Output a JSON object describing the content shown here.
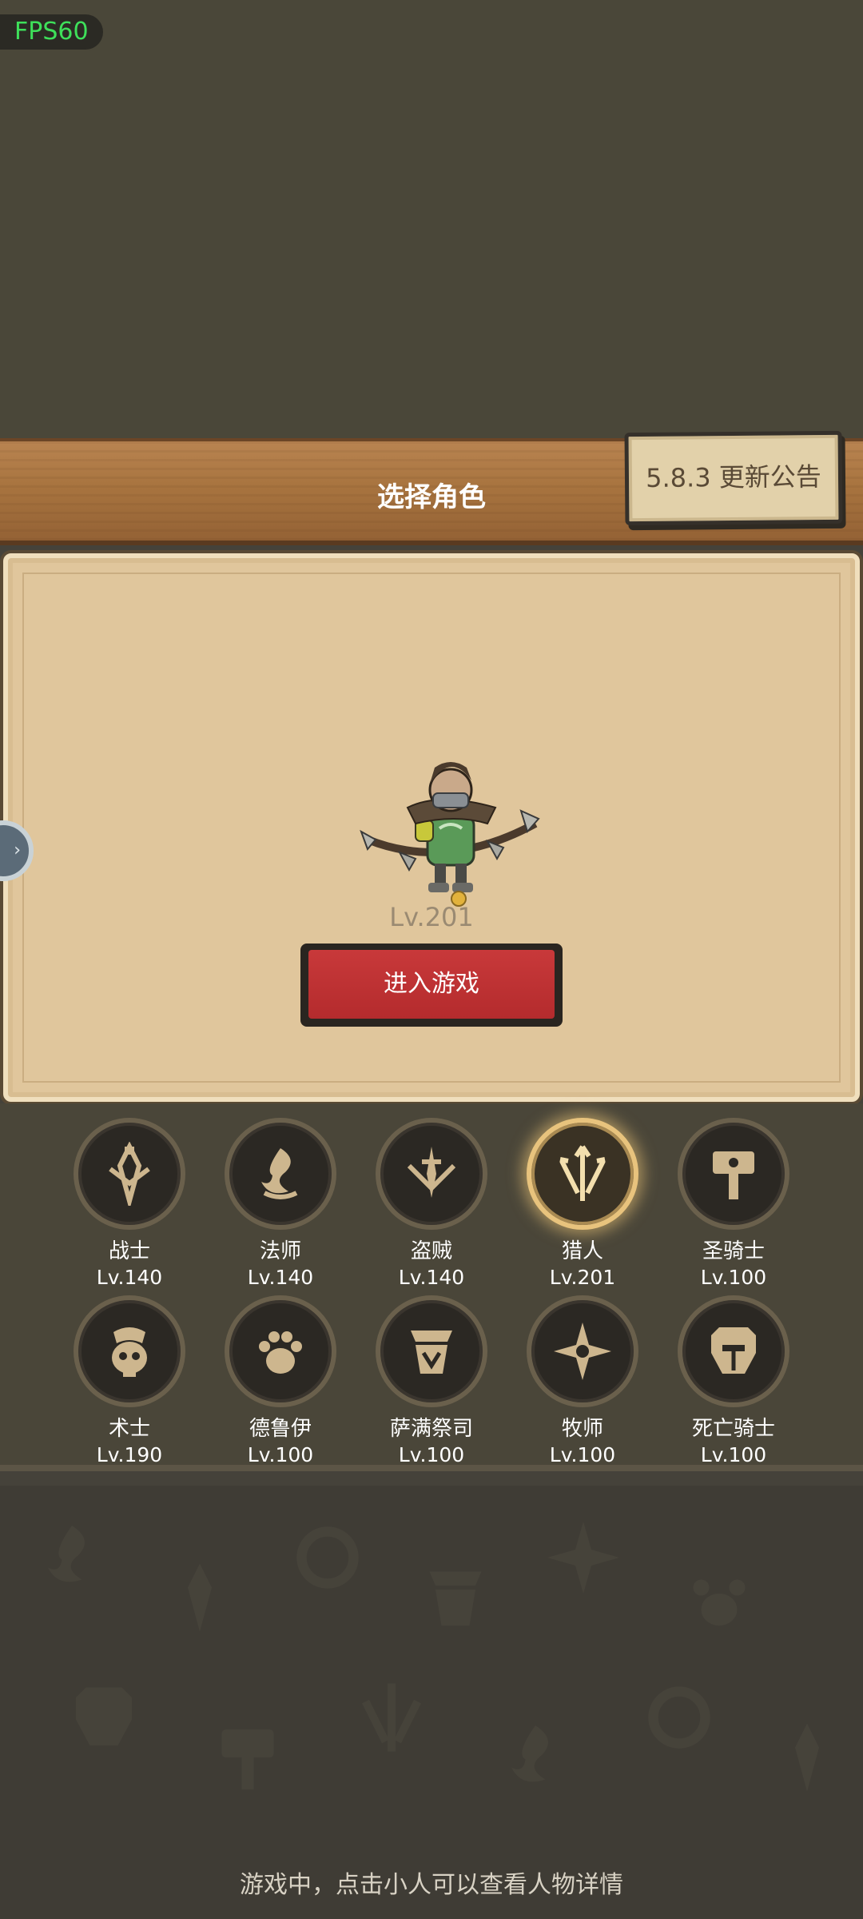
{
  "hud": {
    "fps": "FPS60"
  },
  "header": {
    "title": "选择角色",
    "notice_button": "5.8.3 更新公告"
  },
  "hero": {
    "level": "Lv.201",
    "enter_button": "进入游戏"
  },
  "classes": [
    {
      "name": "战士",
      "level": "Lv.140",
      "icon": "warrior-icon"
    },
    {
      "name": "法师",
      "level": "Lv.140",
      "icon": "mage-icon"
    },
    {
      "name": "盗贼",
      "level": "Lv.140",
      "icon": "rogue-icon"
    },
    {
      "name": "猎人",
      "level": "Lv.201",
      "icon": "hunter-icon",
      "selected": true
    },
    {
      "name": "圣骑士",
      "level": "Lv.100",
      "icon": "paladin-icon"
    },
    {
      "name": "术士",
      "level": "Lv.190",
      "icon": "warlock-icon"
    },
    {
      "name": "德鲁伊",
      "level": "Lv.100",
      "icon": "druid-icon"
    },
    {
      "name": "萨满祭司",
      "level": "Lv.100",
      "icon": "shaman-icon"
    },
    {
      "name": "牧师",
      "level": "Lv.100",
      "icon": "priest-icon"
    },
    {
      "name": "死亡骑士",
      "level": "Lv.100",
      "icon": "death-knight-icon"
    }
  ],
  "footer": {
    "hint": "游戏中，点击小人可以查看人物详情"
  },
  "colors": {
    "accent_gold": "#e8c37d",
    "button_red": "#c8393a",
    "icon_tan": "#cdb68e"
  }
}
